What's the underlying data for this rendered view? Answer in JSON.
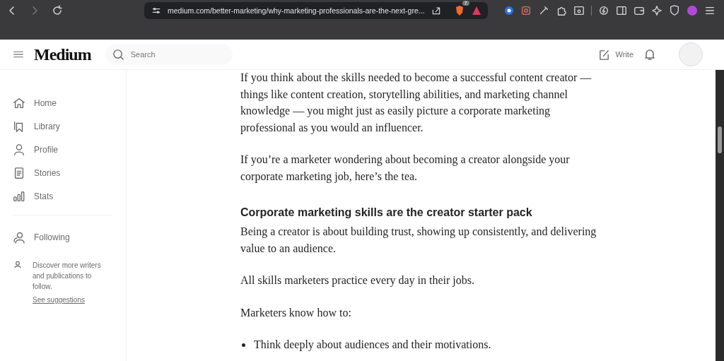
{
  "browser": {
    "url": "medium.com/better-marketing/why-marketing-professionals-are-the-next-gre...",
    "shield_badge": "7"
  },
  "header": {
    "logo": "Medium",
    "search": {
      "placeholder": "Search"
    },
    "write": "Write"
  },
  "sidebar": {
    "items": [
      {
        "label": "Home"
      },
      {
        "label": "Library"
      },
      {
        "label": "Profile"
      },
      {
        "label": "Stories"
      },
      {
        "label": "Stats"
      }
    ],
    "following": "Following",
    "discover": "Discover more writers and publications to follow.",
    "suggestions_link": "See suggestions"
  },
  "article": [
    {
      "kind": "paragraph",
      "text": "If you think about the skills needed to become a successful content creator — things like content creation, storytelling abilities, and marketing channel knowledge — you might just as easily picture a corporate marketing professional as you would an influencer."
    },
    {
      "kind": "paragraph",
      "text": "If you’re a marketer wondering about becoming a creator alongside your corporate marketing job, here’s the tea."
    },
    {
      "kind": "heading",
      "text": "Corporate marketing skills are the creator starter pack"
    },
    {
      "kind": "paragraph",
      "text": "Being a creator is about building trust, showing up consistently, and delivering value to an audience."
    },
    {
      "kind": "paragraph",
      "text": "All skills marketers practice every day in their jobs."
    },
    {
      "kind": "paragraph",
      "text": "Marketers know how to:"
    },
    {
      "kind": "bullet",
      "text": "Think deeply about audiences and their motivations."
    }
  ]
}
